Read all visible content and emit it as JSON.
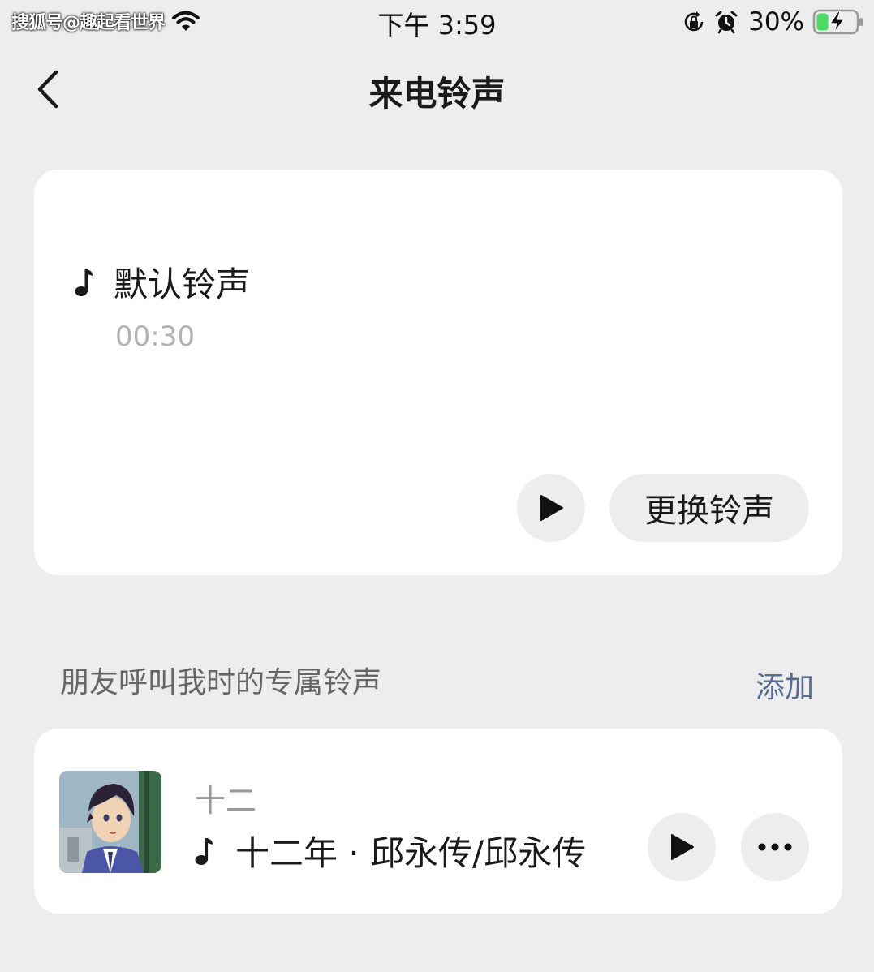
{
  "status_bar": {
    "watermark": "搜狐号@趣起看世界",
    "time": "下午 3:59",
    "battery_percent": "30%",
    "battery_level": 0.3,
    "icons": [
      "wifi-icon",
      "orientation-lock-icon",
      "alarm-icon",
      "battery-charging-icon"
    ]
  },
  "header": {
    "title": "来电铃声",
    "back_icon": "chevron-left-icon"
  },
  "default_ringtone": {
    "name": "默认铃声",
    "duration": "00:30",
    "change_label": "更换铃声",
    "icons": [
      "music-note-icon",
      "play-icon"
    ]
  },
  "friend_section": {
    "title": "朋友呼叫我时的专属铃声",
    "add_label": "添加"
  },
  "friend_ringtones": [
    {
      "friend_name": "十二",
      "song": "十二年 · 邱永传/邱永传",
      "icons": [
        "avatar",
        "music-note-icon",
        "play-icon",
        "more-icon"
      ]
    }
  ],
  "colors": {
    "background": "#ededed",
    "card": "#ffffff",
    "link": "#576b95",
    "muted_text": "#b3b3b3",
    "battery_green": "#4cd964"
  }
}
